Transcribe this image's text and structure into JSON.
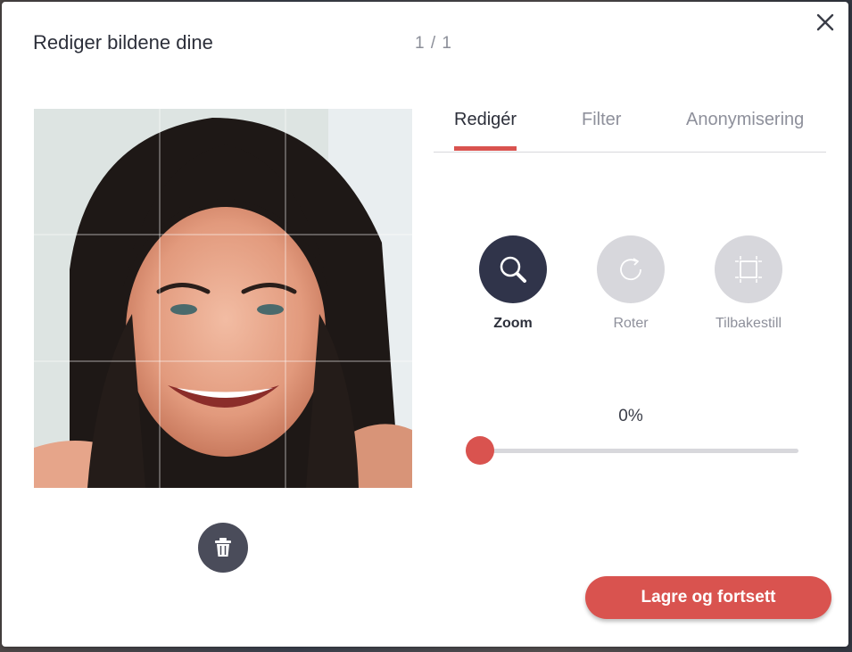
{
  "modal": {
    "title": "Rediger bildene dine",
    "counter": "1 / 1"
  },
  "tabs": [
    {
      "label": "Redigér",
      "active": true
    },
    {
      "label": "Filter",
      "active": false
    },
    {
      "label": "Anonymisering",
      "active": false
    }
  ],
  "tools": [
    {
      "label": "Zoom",
      "icon": "magnifier-icon",
      "active": true
    },
    {
      "label": "Roter",
      "icon": "rotate-icon",
      "active": false
    },
    {
      "label": "Tilbakestill",
      "icon": "reset-crop-icon",
      "active": false
    }
  ],
  "zoom": {
    "value_text": "0%",
    "value": 0
  },
  "actions": {
    "save_label": "Lagre og fortsett"
  },
  "colors": {
    "accent": "#d9534f",
    "dark": "#30344a",
    "inactive_circle": "#d7d7dc"
  }
}
